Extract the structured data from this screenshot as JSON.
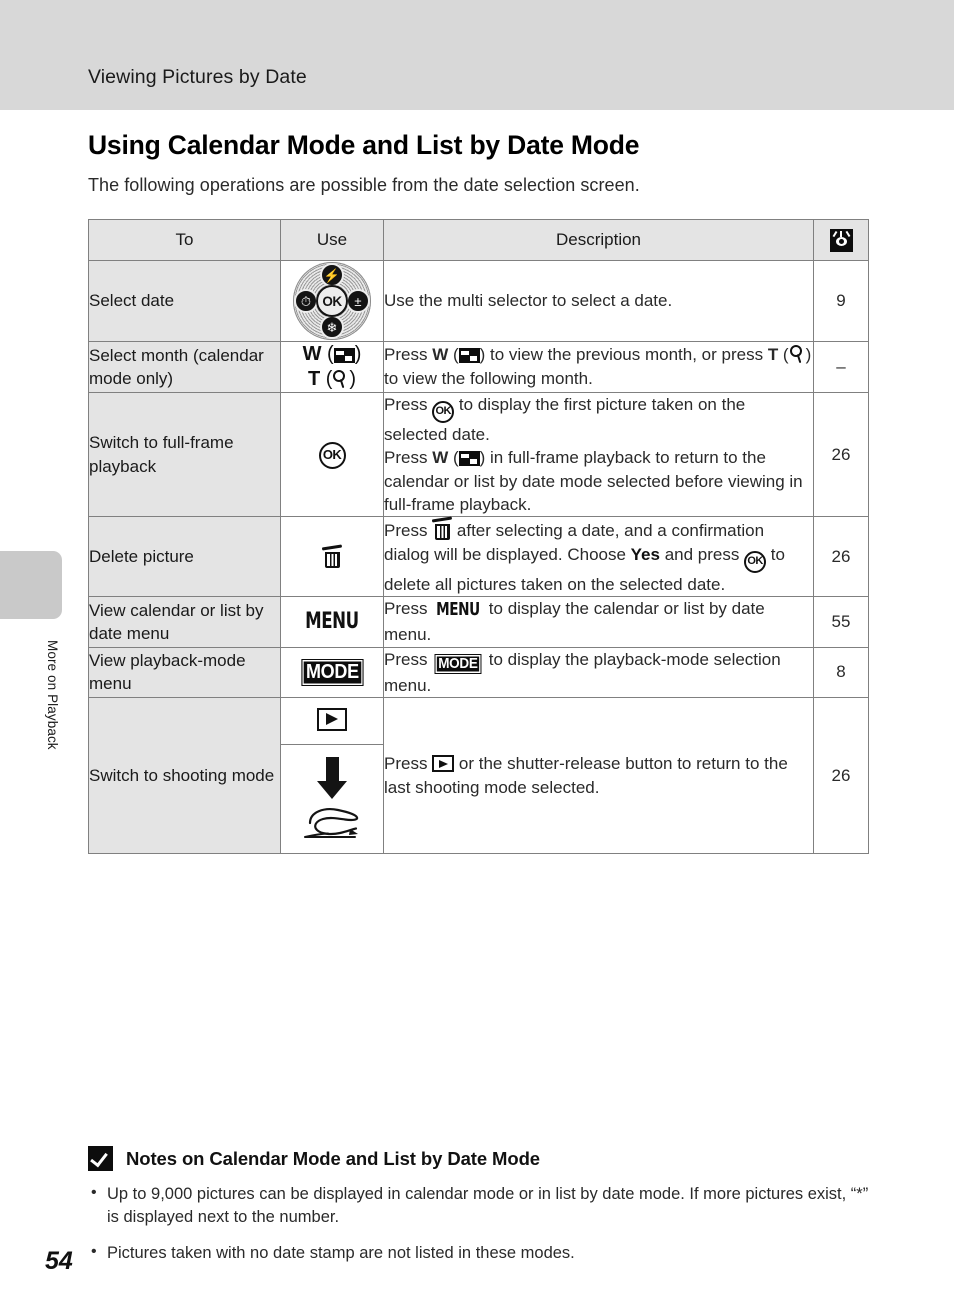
{
  "header": {
    "running_title": "Viewing Pictures by Date"
  },
  "side_tab": {
    "label": "More on Playback"
  },
  "page": {
    "number": "54"
  },
  "section": {
    "title": "Using Calendar Mode and List by Date Mode",
    "intro": "The following operations are possible from the date selection screen."
  },
  "table": {
    "headers": {
      "to": "To",
      "use": "Use",
      "description": "Description",
      "reference_icon": "eye-reference-icon"
    },
    "rows": [
      {
        "to": "Select date",
        "use_icon": "multi-selector-icon",
        "description": "Use the multi selector to select a date.",
        "ref": "9"
      },
      {
        "to": "Select month (calendar mode only)",
        "use_labels": {
          "wide": "W",
          "tele": "T"
        },
        "use_icons": [
          "thumbnail-icon",
          "magnifier-icon"
        ],
        "description_parts": {
          "p1": "Press ",
          "w": "W",
          "p2": ") to view the previous month, or press ",
          "t": "T",
          "p3": ") to view the following month."
        },
        "ref": "–"
      },
      {
        "to": "Switch to full-frame playback",
        "use_icon": "ok-button-icon",
        "description_parts": {
          "l1a": "Press ",
          "l1b": " to display the first picture taken on the selected date.",
          "l2a": "Press ",
          "l2w": "W",
          "l2b": ") in full-frame playback to return to the calendar or list by date mode selected before viewing in full-frame playback."
        },
        "ref": "26"
      },
      {
        "to": "Delete picture",
        "use_icon": "trash-icon",
        "description_parts": {
          "a": "Press ",
          "b": " after selecting a date, and a confirmation dialog will be displayed. Choose ",
          "yes": "Yes",
          "c": " and press ",
          "d": " to delete all pictures taken on the selected date."
        },
        "ref": "26"
      },
      {
        "to": "View calendar or list by date menu",
        "use_label": "MENU",
        "use_icon": "menu-button-icon",
        "description_parts": {
          "a": "Press ",
          "menu": "MENU",
          "b": " to display the calendar or list by date menu."
        },
        "ref": "55"
      },
      {
        "to": "View playback-mode menu",
        "use_label": "MODE",
        "use_icon": "mode-button-icon",
        "description_parts": {
          "a": "Press ",
          "mode": "MODE",
          "b": " to display the playback-mode selection menu."
        },
        "ref": "8"
      },
      {
        "to": "Switch to shooting mode",
        "use_icons": [
          "playback-button-icon",
          "down-arrow-icon",
          "shutter-release-finger-icon"
        ],
        "description_parts": {
          "a": "Press ",
          "b": " or the shutter-release button to return to the last shooting mode selected."
        },
        "ref": "26"
      }
    ]
  },
  "notes": {
    "icon": "caution-check-icon",
    "title": "Notes on Calendar Mode and List by Date Mode",
    "items": [
      "Up to 9,000 pictures can be displayed in calendar mode or in list by date mode. If more pictures exist, “*” is displayed next to the number.",
      "Pictures taken with no date stamp are not listed in these modes."
    ]
  },
  "colors": {
    "header_band": "#d8d8d8",
    "table_shade": "#e4e4e4",
    "rule": "#808080",
    "tab": "#c9c9c9"
  }
}
